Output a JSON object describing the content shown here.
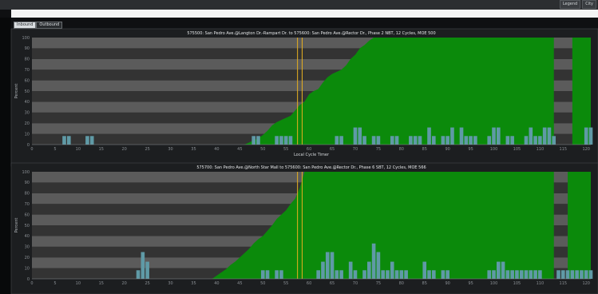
{
  "window": {
    "buttons": [
      "Legend",
      "City"
    ]
  },
  "tabs": [
    {
      "label": "Inbound",
      "active": true
    },
    {
      "label": "Outbound",
      "active": false
    }
  ],
  "colors": {
    "green": "#0b8a0b",
    "bar": "#5f9aa6",
    "yellow": "#e8b020",
    "band_light": "#5b5b5b",
    "band_dark": "#333333"
  },
  "chart_data": [
    {
      "type": "bar",
      "title": "575500: San Pedro Ave.@Langton Dr.-Rampart Dr. to 575600: San Pedro Ave.@Rector Dr., Phase 2 NBT, 12 Cycles, MOE 500",
      "xlabel": "Local Cycle Timer",
      "ylabel": "Percent",
      "xlim": [
        0,
        121
      ],
      "ylim": [
        0,
        100
      ],
      "x_ticks": [
        0,
        5,
        10,
        15,
        20,
        25,
        30,
        35,
        40,
        45,
        50,
        55,
        60,
        65,
        70,
        75,
        80,
        85,
        90,
        95,
        100,
        105,
        110,
        115,
        120
      ],
      "y_ticks": [
        0,
        10,
        20,
        30,
        40,
        50,
        60,
        70,
        80,
        90,
        100
      ],
      "yellow_lines": [
        57.5,
        58.5
      ],
      "cumulative_arrivals": {
        "x": [
          0,
          46,
          47,
          48,
          49,
          50,
          51,
          52,
          53,
          54,
          55,
          56,
          57,
          58,
          59,
          60,
          61,
          62,
          63,
          64,
          65,
          66,
          67,
          68,
          69,
          70,
          71,
          72,
          73,
          74,
          75,
          113,
          113,
          117,
          117,
          121
        ],
        "y": [
          0,
          0,
          2,
          4,
          6,
          9,
          13,
          18,
          21,
          23,
          25,
          27,
          32,
          37,
          40,
          47,
          50,
          52,
          58,
          63,
          66,
          68,
          70,
          74,
          80,
          84,
          90,
          93,
          97,
          100,
          100,
          100,
          0,
          0,
          100,
          100
        ]
      },
      "bars": {
        "x": [
          7,
          8,
          12,
          13,
          48,
          49,
          53,
          54,
          55,
          56,
          66,
          67,
          70,
          71,
          72,
          74,
          75,
          78,
          79,
          82,
          83,
          84,
          86,
          87,
          89,
          90,
          91,
          93,
          94,
          95,
          96,
          99,
          100,
          101,
          103,
          104,
          107,
          108,
          109,
          110,
          111,
          112,
          113,
          120,
          121
        ],
        "y": [
          8,
          8,
          8,
          8,
          8,
          8,
          8,
          8,
          8,
          8,
          8,
          8,
          16,
          16,
          8,
          8,
          8,
          8,
          8,
          8,
          8,
          8,
          16,
          8,
          8,
          8,
          16,
          16,
          8,
          8,
          8,
          8,
          16,
          16,
          8,
          8,
          8,
          16,
          8,
          8,
          16,
          16,
          8,
          16,
          16
        ]
      }
    },
    {
      "type": "bar",
      "title": "575700: San Pedro Ave.@North Star Mall to 575600: San Pedro Ave.@Rector Dr., Phase 6 SBT, 12 Cycles, MOE 566",
      "xlabel": "",
      "ylabel": "Percent",
      "xlim": [
        0,
        121
      ],
      "ylim": [
        0,
        100
      ],
      "x_ticks": [
        0,
        5,
        10,
        15,
        20,
        25,
        30,
        35,
        40,
        45,
        50,
        55,
        60,
        65,
        70,
        75,
        80,
        85,
        90,
        95,
        100,
        105,
        110,
        115,
        120
      ],
      "y_ticks": [
        0,
        10,
        20,
        30,
        40,
        50,
        60,
        70,
        80,
        90,
        100
      ],
      "yellow_lines": [
        57.5,
        58.5
      ],
      "cumulative_arrivals": {
        "x": [
          0,
          39,
          40,
          41,
          42,
          43,
          44,
          45,
          46,
          47,
          48,
          49,
          50,
          51,
          52,
          53,
          54,
          55,
          56,
          57,
          58,
          59,
          60,
          113,
          113,
          116,
          116,
          121
        ],
        "y": [
          0,
          0,
          3,
          6,
          9,
          13,
          16,
          20,
          24,
          28,
          33,
          37,
          40,
          45,
          50,
          56,
          60,
          64,
          70,
          75,
          85,
          100,
          100,
          100,
          0,
          0,
          100,
          100
        ]
      },
      "bars": {
        "x": [
          23,
          24,
          25,
          50,
          51,
          53,
          54,
          62,
          63,
          64,
          65,
          66,
          67,
          69,
          70,
          72,
          73,
          74,
          75,
          76,
          77,
          78,
          79,
          80,
          81,
          85,
          86,
          87,
          89,
          90,
          99,
          100,
          101,
          102,
          103,
          104,
          105,
          106,
          107,
          108,
          109,
          110,
          114,
          115,
          116,
          117,
          118,
          119,
          120,
          121
        ],
        "y": [
          8,
          25,
          16,
          8,
          8,
          8,
          8,
          8,
          16,
          25,
          25,
          8,
          8,
          16,
          8,
          8,
          16,
          33,
          25,
          8,
          8,
          16,
          8,
          8,
          8,
          16,
          8,
          8,
          8,
          8,
          8,
          8,
          16,
          16,
          8,
          8,
          8,
          8,
          8,
          8,
          8,
          8,
          8,
          8,
          8,
          8,
          8,
          8,
          8,
          8
        ]
      }
    }
  ]
}
